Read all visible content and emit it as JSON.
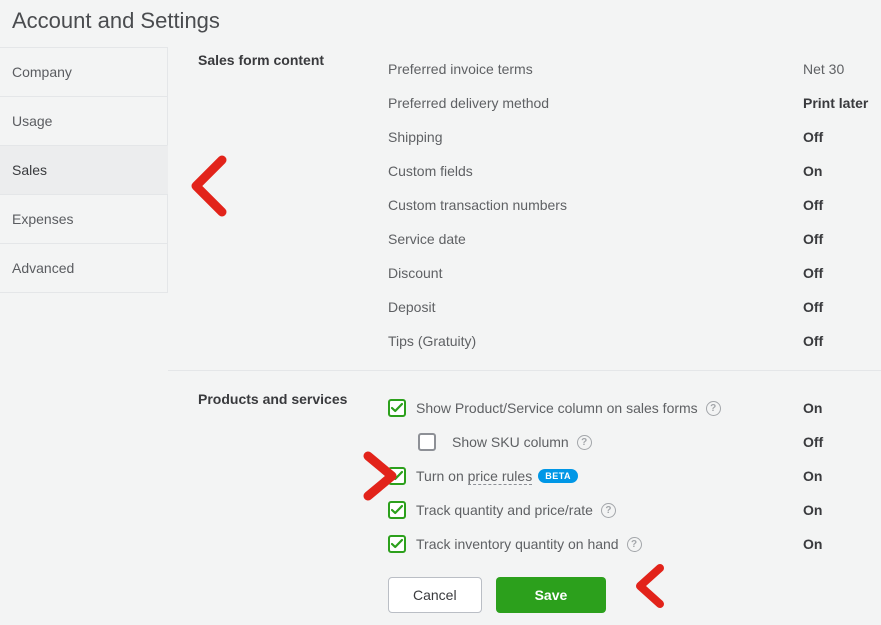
{
  "page_title": "Account and Settings",
  "sidebar": {
    "items": [
      {
        "label": "Company",
        "active": false
      },
      {
        "label": "Usage",
        "active": false
      },
      {
        "label": "Sales",
        "active": true
      },
      {
        "label": "Expenses",
        "active": false
      },
      {
        "label": "Advanced",
        "active": false
      }
    ]
  },
  "sections": {
    "sales_form": {
      "label": "Sales form content",
      "rows": [
        {
          "label": "Preferred invoice terms",
          "value": "Net 30",
          "value_light": true
        },
        {
          "label": "Preferred delivery method",
          "value": "Print later"
        },
        {
          "label": "Shipping",
          "value": "Off"
        },
        {
          "label": "Custom fields",
          "value": "On"
        },
        {
          "label": "Custom transaction numbers",
          "value": "Off"
        },
        {
          "label": "Service date",
          "value": "Off"
        },
        {
          "label": "Discount",
          "value": "Off"
        },
        {
          "label": "Deposit",
          "value": "Off"
        },
        {
          "label": "Tips (Gratuity)",
          "value": "Off"
        }
      ]
    },
    "products_services": {
      "label": "Products and services",
      "rows": [
        {
          "label": "Show Product/Service column on sales forms",
          "value": "On",
          "checked": true,
          "help": true
        },
        {
          "label": "Show SKU column",
          "value": "Off",
          "checked": false,
          "help": true,
          "indent": true
        },
        {
          "label_prefix": "Turn on ",
          "label_underlined": "price rules",
          "value": "On",
          "checked": true,
          "beta": "BETA"
        },
        {
          "label": "Track quantity and price/rate",
          "value": "On",
          "checked": true,
          "help": true
        },
        {
          "label": "Track inventory quantity on hand",
          "value": "On",
          "checked": true,
          "help": true
        }
      ],
      "actions": {
        "cancel": "Cancel",
        "save": "Save"
      }
    }
  }
}
